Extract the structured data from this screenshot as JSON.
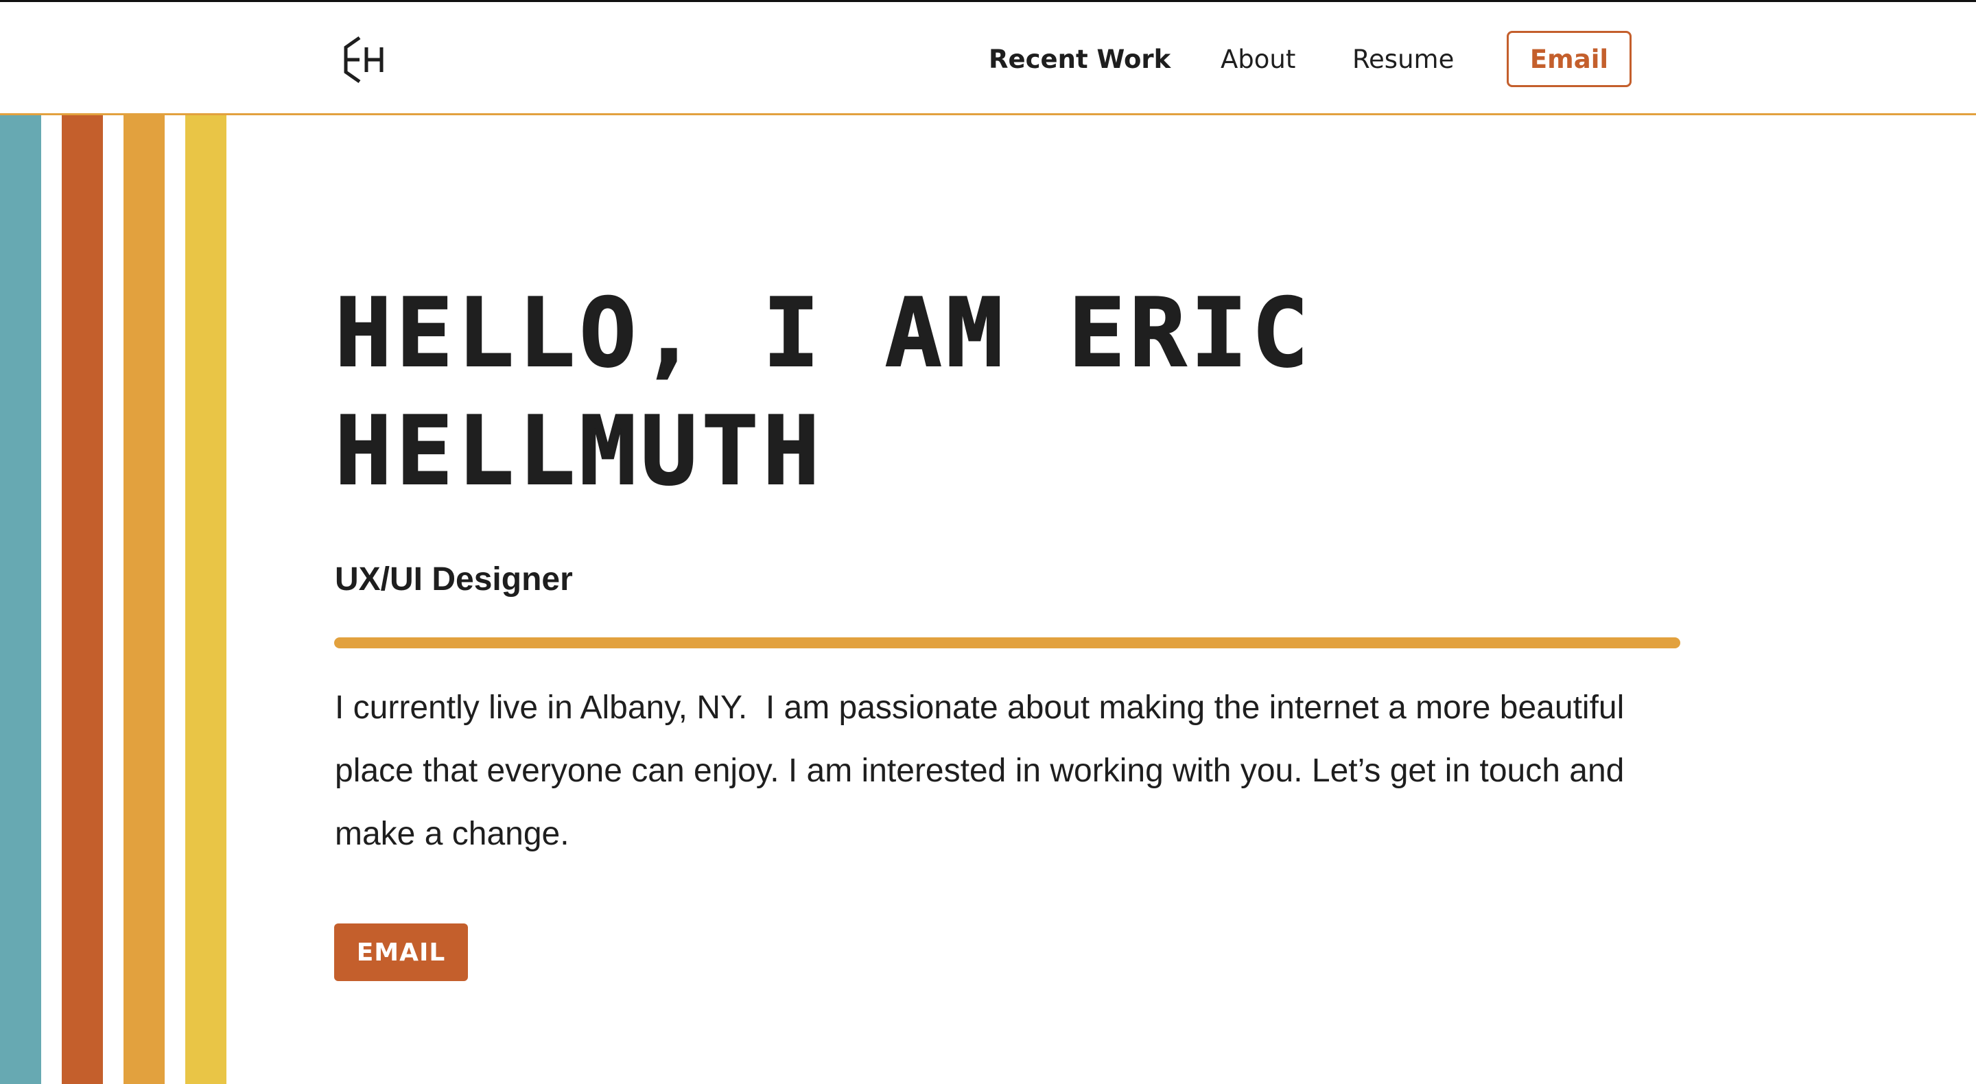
{
  "header": {
    "logo_icon": "eh-monogram-logo",
    "nav": {
      "recent_work": "Recent Work",
      "about": "About",
      "resume": "Resume",
      "email": "Email"
    }
  },
  "hero": {
    "title_line1": "HELLO, I AM ERIC",
    "title_line2": "HELLMUTH",
    "role": "UX/UI Designer",
    "bio": "I currently live in Albany, NY.  I am passionate about making the internet a more beautiful place that everyone can enjoy. I am interested in working with you. Let’s get in touch and make a change.",
    "cta": "EMAIL"
  },
  "colors": {
    "accent_orange": "#c45f2c",
    "accent_amber": "#e2a13e",
    "accent_yellow": "#e9c546",
    "accent_teal": "#67a9b2",
    "text": "#1e1e1e"
  }
}
